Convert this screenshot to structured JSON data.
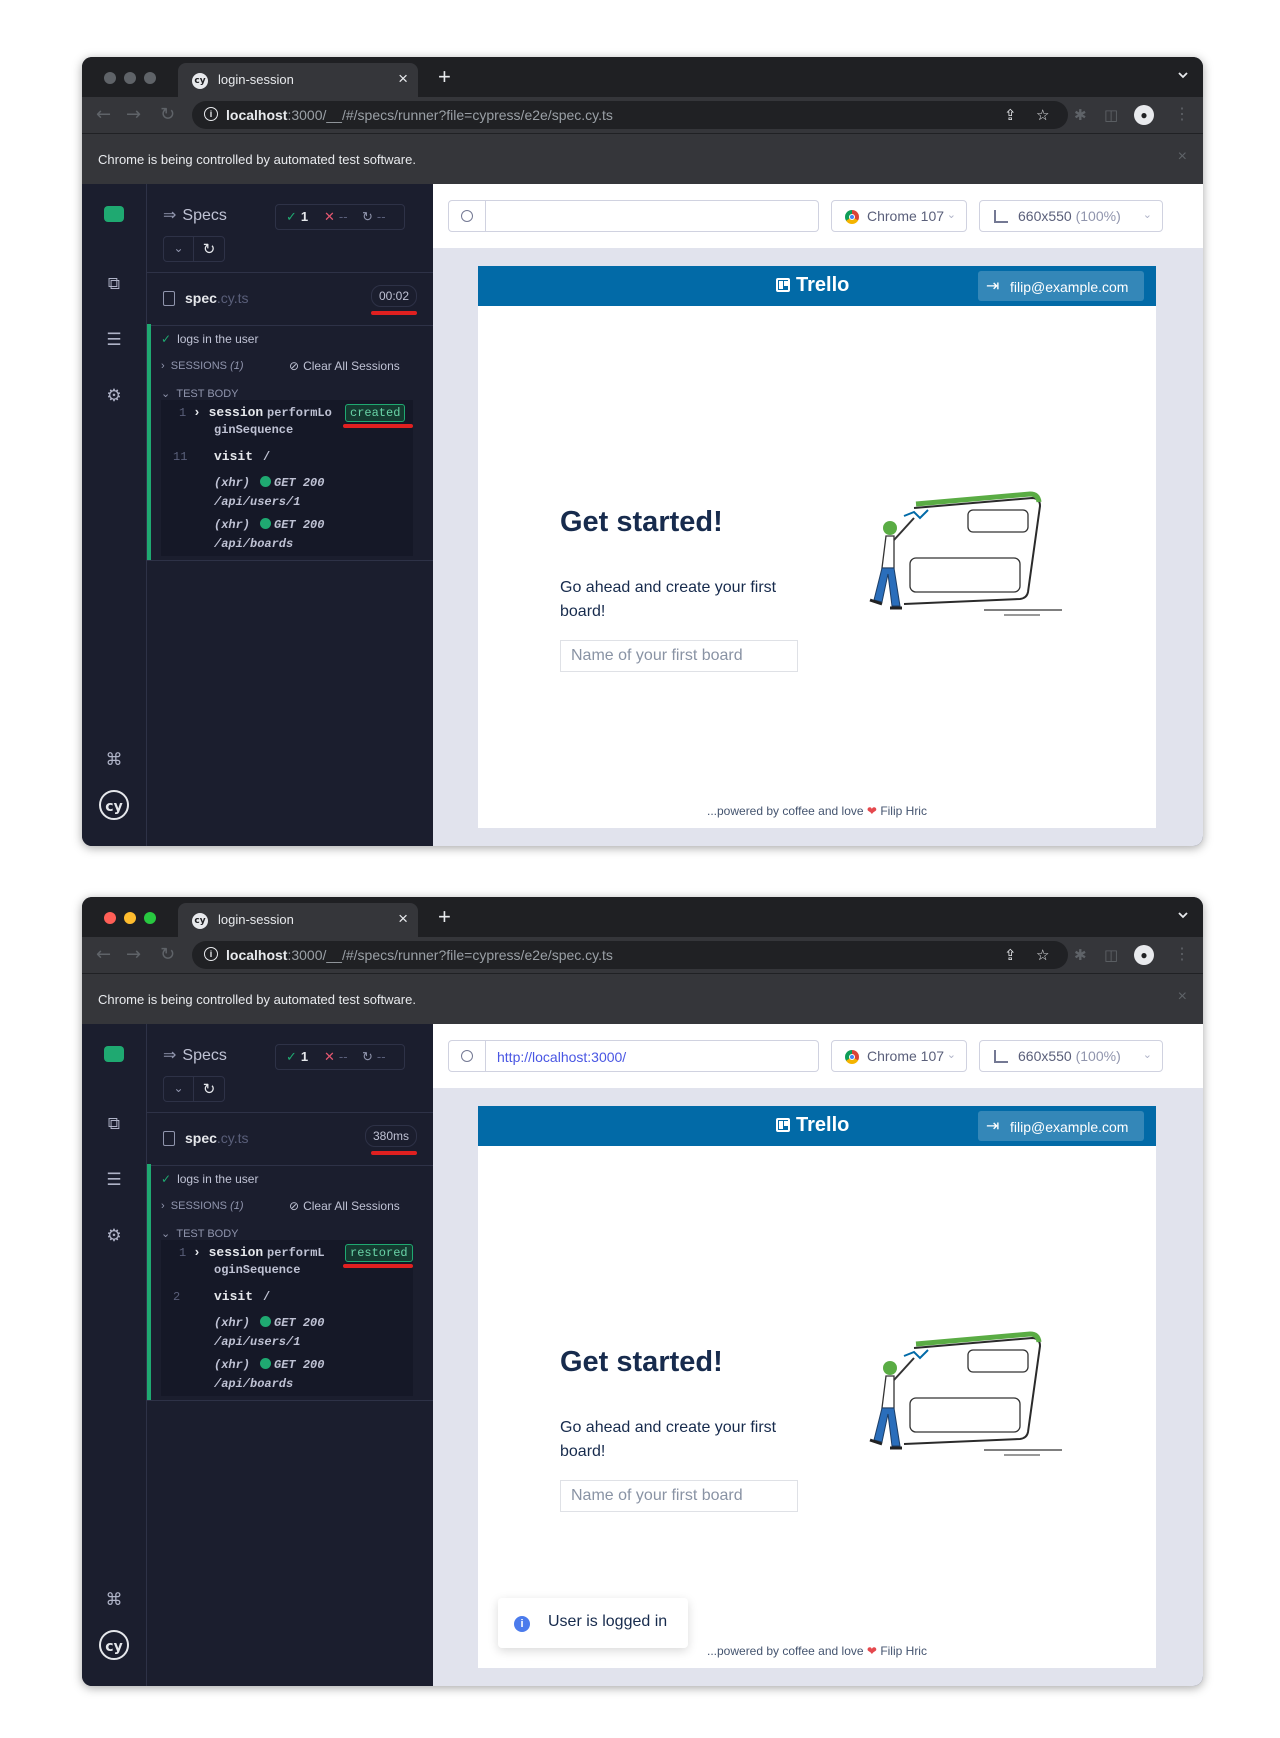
{
  "windows": [
    {
      "tab_title": "login-session",
      "favicon": "cy",
      "url_host": "localhost",
      "url_rest": ":3000/__/#/specs/runner?file=cypress/e2e/spec.cy.ts",
      "infobar_text": "Chrome is being controlled by automated test software.",
      "specs_label": "Specs",
      "stats": {
        "passed": "1",
        "failed": "--",
        "pending": "--"
      },
      "spec_name": "spec",
      "spec_ext": ".cy.ts",
      "duration": "00:02",
      "test_title": "logs in the user",
      "sessions_label": "SESSIONS",
      "sessions_count": "(1)",
      "clear_sessions": "Clear All Sessions",
      "test_body_label": "TEST BODY",
      "cmd1": {
        "num": "1",
        "name": "session",
        "msg1": "performLo",
        "msg2": "ginSequence",
        "badge": "created"
      },
      "cmd2": {
        "num": "11",
        "name": "visit",
        "msg": "/"
      },
      "xhr1": {
        "label": "(xhr)",
        "method": "GET 200",
        "path": "/api/users/1"
      },
      "xhr2": {
        "label": "(xhr)",
        "method": "GET 200",
        "path": "/api/boards"
      },
      "aut_url": "",
      "browser": "Chrome 107",
      "viewport": "660x550",
      "viewport_pct": "(100%)",
      "trello_brand": "Trello",
      "user_email": "filip@example.com",
      "hero_title": "Get started!",
      "hero_sub": "Go ahead and create your first board!",
      "board_placeholder": "Name of your first board",
      "footer_text": "...powered by coffee and love",
      "footer_author": "Filip Hric",
      "toast": null
    },
    {
      "tab_title": "login-session",
      "favicon": "cy",
      "url_host": "localhost",
      "url_rest": ":3000/__/#/specs/runner?file=cypress/e2e/spec.cy.ts",
      "infobar_text": "Chrome is being controlled by automated test software.",
      "specs_label": "Specs",
      "stats": {
        "passed": "1",
        "failed": "--",
        "pending": "--"
      },
      "spec_name": "spec",
      "spec_ext": ".cy.ts",
      "duration": "380ms",
      "test_title": "logs in the user",
      "sessions_label": "SESSIONS",
      "sessions_count": "(1)",
      "clear_sessions": "Clear All Sessions",
      "test_body_label": "TEST BODY",
      "cmd1": {
        "num": "1",
        "name": "session",
        "msg1": "performL",
        "msg2": "oginSequence",
        "badge": "restored"
      },
      "cmd2": {
        "num": "2",
        "name": "visit",
        "msg": "/"
      },
      "xhr1": {
        "label": "(xhr)",
        "method": "GET 200",
        "path": "/api/users/1"
      },
      "xhr2": {
        "label": "(xhr)",
        "method": "GET 200",
        "path": "/api/boards"
      },
      "aut_url": "http://localhost:3000/",
      "browser": "Chrome 107",
      "viewport": "660x550",
      "viewport_pct": "(100%)",
      "trello_brand": "Trello",
      "user_email": "filip@example.com",
      "hero_title": "Get started!",
      "hero_sub": "Go ahead and create your first board!",
      "board_placeholder": "Name of your first board",
      "footer_text": "...powered by coffee and love",
      "footer_author": "Filip Hric",
      "toast": "User is logged in"
    }
  ],
  "colors": {
    "traffic_inactive": "#5f6368",
    "traffic_red": "#ff5f57",
    "traffic_yellow": "#febc2e",
    "traffic_green": "#28c840",
    "cypress_green": "#1fa971",
    "trello_blue": "#026aa7",
    "highlight_red": "#e02020"
  },
  "icons": {
    "runs": "specs-list-icon",
    "debug": "debug-icon",
    "tests": "test-list-icon",
    "settings": "gear-icon",
    "shortcuts": "command-icon",
    "logo": "cypress-logo"
  }
}
